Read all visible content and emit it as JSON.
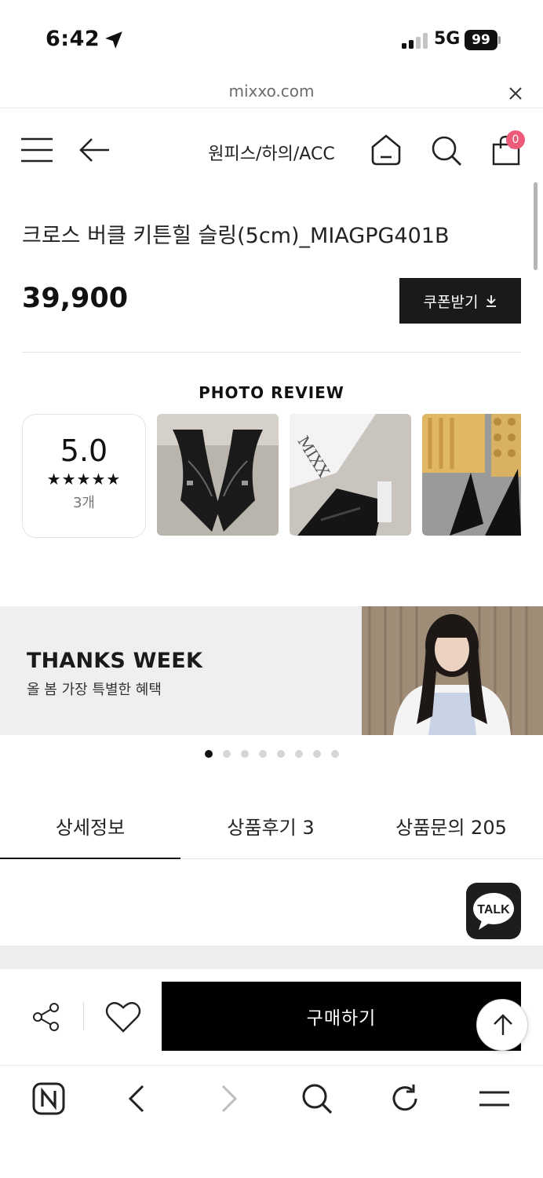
{
  "status_bar": {
    "time": "6:42",
    "network": "5G",
    "battery": "99"
  },
  "url_bar": {
    "url": "mixxo.com"
  },
  "header": {
    "category_title": "원피스/하의/ACC",
    "cart_count": "0"
  },
  "product": {
    "title": "크로스 버클 키튼힐 슬링(5cm)_MIAGPG401B",
    "price": "39,900",
    "coupon_label": "쿠폰받기",
    "coupon_icon": "download-arrow-icon"
  },
  "photo_review": {
    "heading": "PHOTO REVIEW",
    "score": "5.0",
    "stars": "★★★★★",
    "count": "3개"
  },
  "banner": {
    "title": "THANKS WEEK",
    "subtitle": "올 봄 가장 특별한 혜택",
    "slide_count": 8,
    "active_slide": 1
  },
  "tabs": [
    {
      "label": "상세정보",
      "active": true
    },
    {
      "label": "상품후기 3",
      "active": false
    },
    {
      "label": "상품문의 205",
      "active": false
    }
  ],
  "talk_button": {
    "label": "TALK"
  },
  "action_bar": {
    "buy_label": "구매하기"
  },
  "browser_toolbar": {
    "icons": [
      "naver-n-icon",
      "back-icon",
      "forward-icon",
      "search-icon",
      "reload-icon",
      "menu-icon"
    ]
  },
  "colors": {
    "accent_badge": "#ee5a7a",
    "primary_button": "#000000",
    "coupon_button": "#1a1a1a"
  }
}
